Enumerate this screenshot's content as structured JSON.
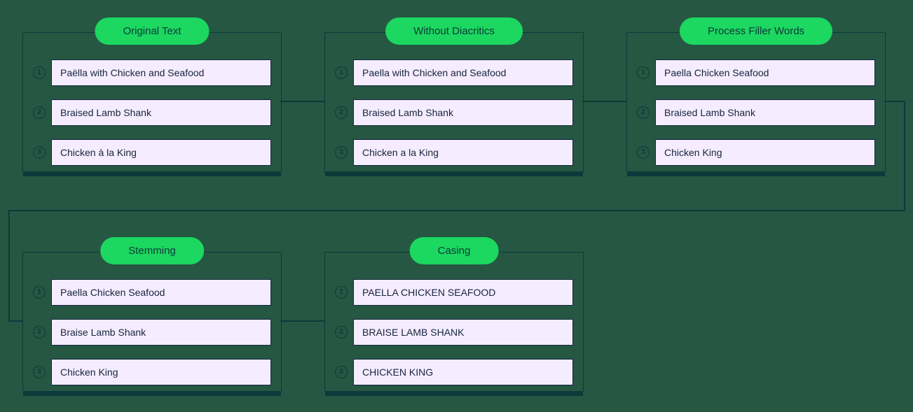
{
  "stages": [
    {
      "title": "Original Text",
      "items": [
        "Paëlla with Chicken and Seafood",
        "Braised Lamb Shank",
        "Chicken à la King"
      ]
    },
    {
      "title": "Without Diacritics",
      "items": [
        "Paella with Chicken and Seafood",
        "Braised Lamb Shank",
        "Chicken a la King"
      ]
    },
    {
      "title": "Process Filler Words",
      "items": [
        "Paella Chicken Seafood",
        "Braised Lamb Shank",
        "Chicken King"
      ]
    },
    {
      "title": "Stemming",
      "items": [
        "Paella Chicken Seafood",
        "Braise Lamb Shank",
        "Chicken King"
      ]
    },
    {
      "title": "Casing",
      "items": [
        "PAELLA CHICKEN SEAFOOD",
        "BRAISE LAMB SHANK",
        "CHICKEN KING"
      ]
    }
  ],
  "row_numbers": [
    "1",
    "2",
    "3"
  ]
}
